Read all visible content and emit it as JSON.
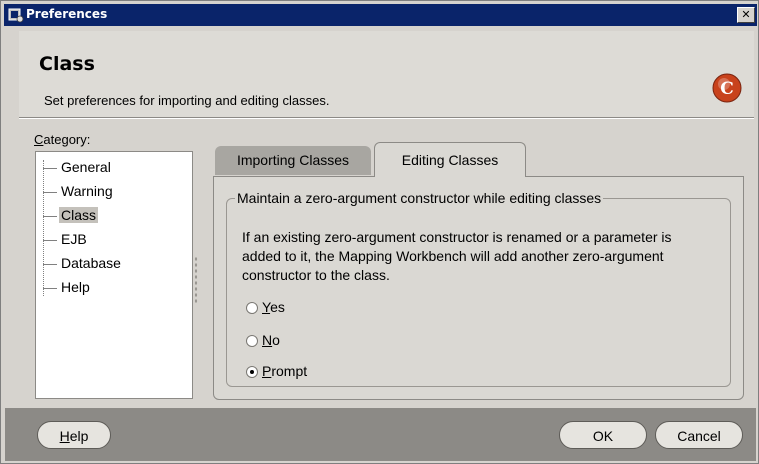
{
  "window": {
    "title": "Preferences",
    "close_glyph": "✕"
  },
  "header": {
    "title": "Class",
    "subtitle": "Set preferences for importing and editing classes.",
    "logo_icon": "oracle-c-logo-icon"
  },
  "category": {
    "label_mnemonic": "C",
    "label_rest": "ategory:",
    "items": [
      {
        "label": "General",
        "selected": false
      },
      {
        "label": "Warning",
        "selected": false
      },
      {
        "label": "Class",
        "selected": true
      },
      {
        "label": "EJB",
        "selected": false
      },
      {
        "label": "Database",
        "selected": false
      },
      {
        "label": "Help",
        "selected": false
      }
    ]
  },
  "tabs": [
    {
      "label": "Importing Classes",
      "active": false
    },
    {
      "label": "Editing Classes",
      "active": true
    }
  ],
  "group": {
    "title": "Maintain a zero-argument constructor while editing classes",
    "description": "If an existing zero-argument constructor is renamed or a parameter is added to it, the Mapping Workbench will add another zero-argument constructor to the class.",
    "options": [
      {
        "mnemonic": "Y",
        "rest": "es",
        "checked": false
      },
      {
        "mnemonic": "N",
        "rest": "o",
        "checked": false
      },
      {
        "mnemonic": "P",
        "rest": "rompt",
        "checked": true
      }
    ]
  },
  "buttons": {
    "help_mnemonic": "H",
    "help_rest": "elp",
    "ok": "OK",
    "cancel": "Cancel"
  },
  "colors": {
    "titlebar": "#0a246a",
    "window_bg": "#d6d3ce",
    "footer_bg": "#8c8a86",
    "logo_red": "#c8421c"
  }
}
